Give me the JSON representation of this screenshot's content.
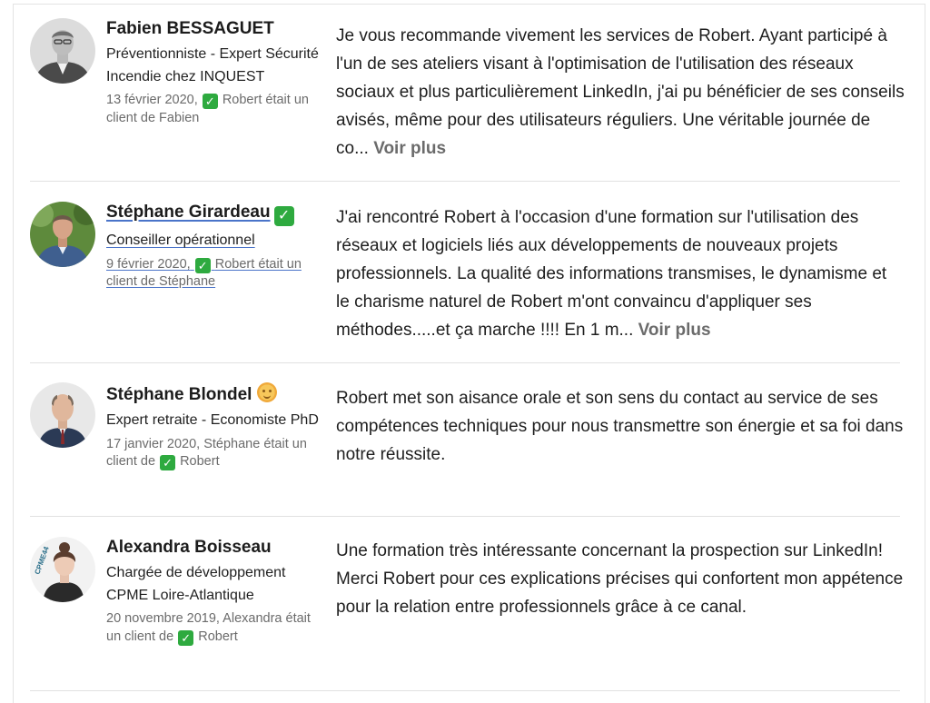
{
  "recommendations": [
    {
      "name": "Fabien BESSAGUET",
      "headline": "Préventionniste - Expert Sécurité Incendie chez INQUEST",
      "date_before": "13 février 2020,",
      "date_after": "Robert était un client de Fabien",
      "text": "Je vous recommande vivement les services de Robert. Ayant participé à l'un de ses ateliers visant à l'optimisation de l'utilisation des réseaux sociaux et plus particulièrement LinkedIn, j'ai pu bénéficier de ses conseils avisés, même pour des utilisateurs réguliers. Une véritable journée de co...",
      "more": "Voir plus"
    },
    {
      "name": "Stéphane Girardeau",
      "headline": "Conseiller opérationnel",
      "date_before": "9 février 2020,",
      "date_after": "Robert était un client de Stéphane",
      "text": "J'ai rencontré Robert à l'occasion d'une formation sur l'utilisation des réseaux et logiciels liés aux développements de nouveaux projets professionnels. La qualité des informations transmises, le dynamisme et le charisme naturel de Robert m'ont convaincu d'appliquer ses méthodes.....et ça marche !!!! En 1 m...",
      "more": "Voir plus"
    },
    {
      "name": "Stéphane Blondel",
      "headline": "Expert retraite - Economiste PhD",
      "date_before": "17 janvier 2020, Stéphane était un client de",
      "date_after": "Robert",
      "text": "Robert met son aisance orale et son sens du contact au service de ses compétences techniques pour nous transmettre son énergie et sa foi dans notre réussite."
    },
    {
      "name": "Alexandra Boisseau",
      "headline": "Chargée de développement CPME Loire-Atlantique",
      "date_before": "20 novembre 2019, Alexandra était un client de",
      "date_after": "Robert",
      "text": "Une formation très intéressante concernant la prospection sur LinkedIn! Merci Robert pour ces explications précises qui confortent mon appétence pour la relation entre professionnels grâce à ce canal.",
      "avatar_logo_text": "CPME44"
    }
  ],
  "icons": {
    "check": "check-mark-emoji",
    "sun": "sun-face-emoji"
  },
  "colors": {
    "check_green": "#2eaa3f",
    "link_underline": "#4a74c9",
    "more_gray": "#6b6b6b"
  }
}
